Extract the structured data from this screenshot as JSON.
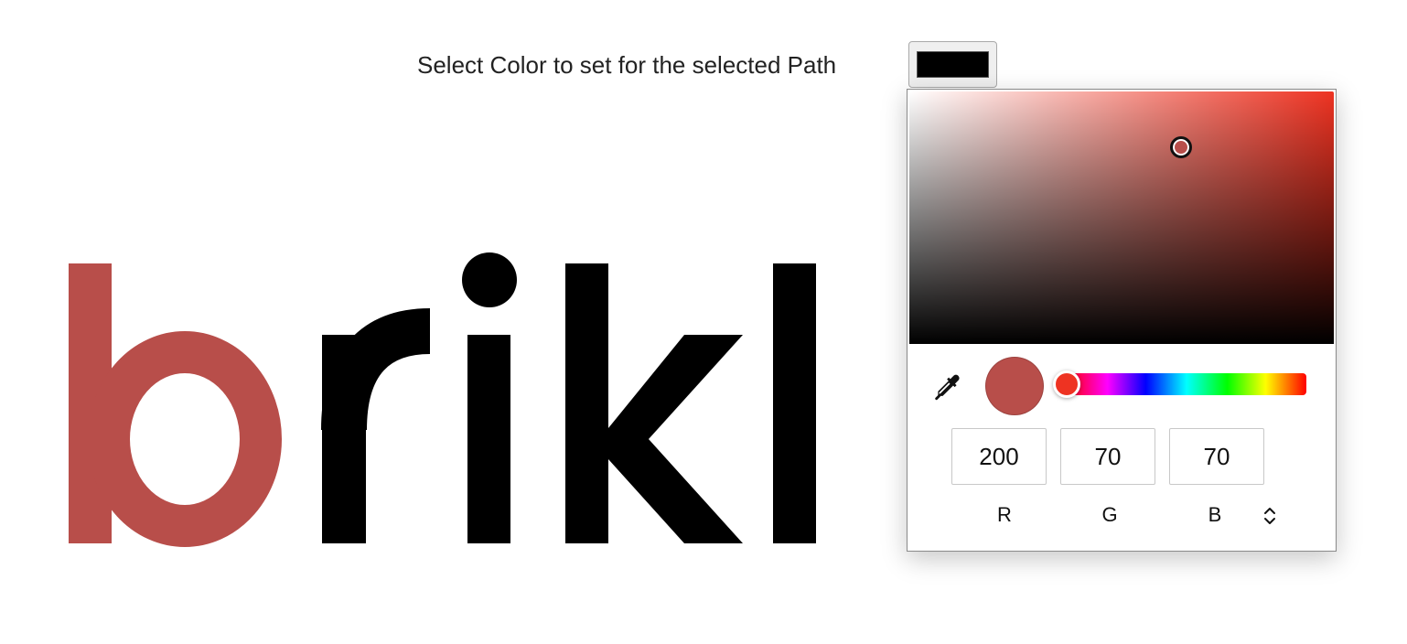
{
  "prompt": {
    "label": "Select Color to set for the selected Path"
  },
  "swatch": {
    "color": "#000000"
  },
  "logo": {
    "letters": [
      "b",
      "r",
      "i",
      "k",
      "l"
    ],
    "highlight_color": "#b84e4a",
    "base_color": "#000000"
  },
  "picker": {
    "hue_color": "#ee3322",
    "selected_color": "#b84e4a",
    "saturation": 0.64,
    "value": 0.78,
    "hue_fraction": 0.0,
    "channels": [
      {
        "label": "R",
        "value": "200"
      },
      {
        "label": "G",
        "value": "70"
      },
      {
        "label": "B",
        "value": "70"
      }
    ]
  }
}
